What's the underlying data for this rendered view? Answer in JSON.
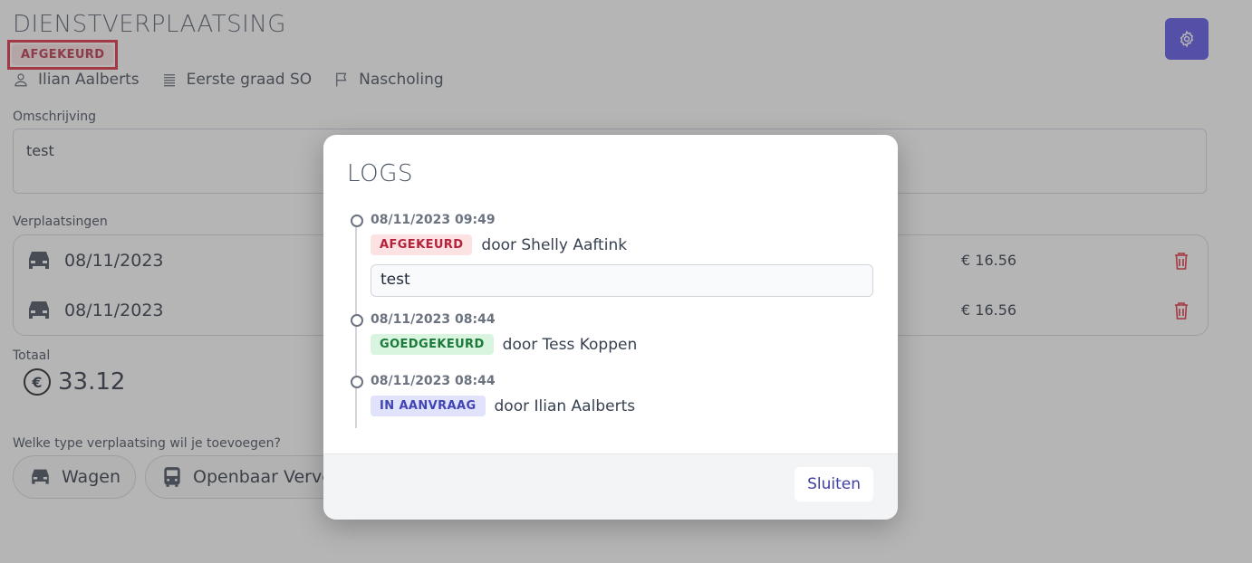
{
  "header": {
    "title": "DIENSTVERPLAATSING",
    "status": "AFGEKEURD"
  },
  "meta": {
    "person": "Ilian Aalberts",
    "level": "Eerste graad SO",
    "type": "Nascholing"
  },
  "description": {
    "label": "Omschrijving",
    "value": "test"
  },
  "trips": {
    "label": "Verplaatsingen",
    "rows": [
      {
        "date": "08/11/2023",
        "amount": "€ 16.56"
      },
      {
        "date": "08/11/2023",
        "amount": "€ 16.56"
      }
    ]
  },
  "total": {
    "label": "Totaal",
    "value": "33.12"
  },
  "add": {
    "label": "Welke type verplaatsing wil je toevoegen?",
    "options": [
      "Wagen",
      "Openbaar Vervoer"
    ]
  },
  "modal": {
    "title": "LOGS",
    "entries": [
      {
        "timestamp": "08/11/2023 09:49",
        "status": "AFGEKEURD",
        "by": "door Shelly Aaftink",
        "comment": "test"
      },
      {
        "timestamp": "08/11/2023 08:44",
        "status": "GOEDGEKEURD",
        "by": "door Tess Koppen"
      },
      {
        "timestamp": "08/11/2023 08:44",
        "status": "IN AANVRAAG",
        "by": "door Ilian Aalberts"
      }
    ],
    "close_label": "Sluiten"
  },
  "colors": {
    "accent": "#4f46e5",
    "danger": "#e11d2e",
    "status_red": "#b4233b",
    "status_green": "#1b7a3a",
    "status_blue": "#4045b3"
  }
}
